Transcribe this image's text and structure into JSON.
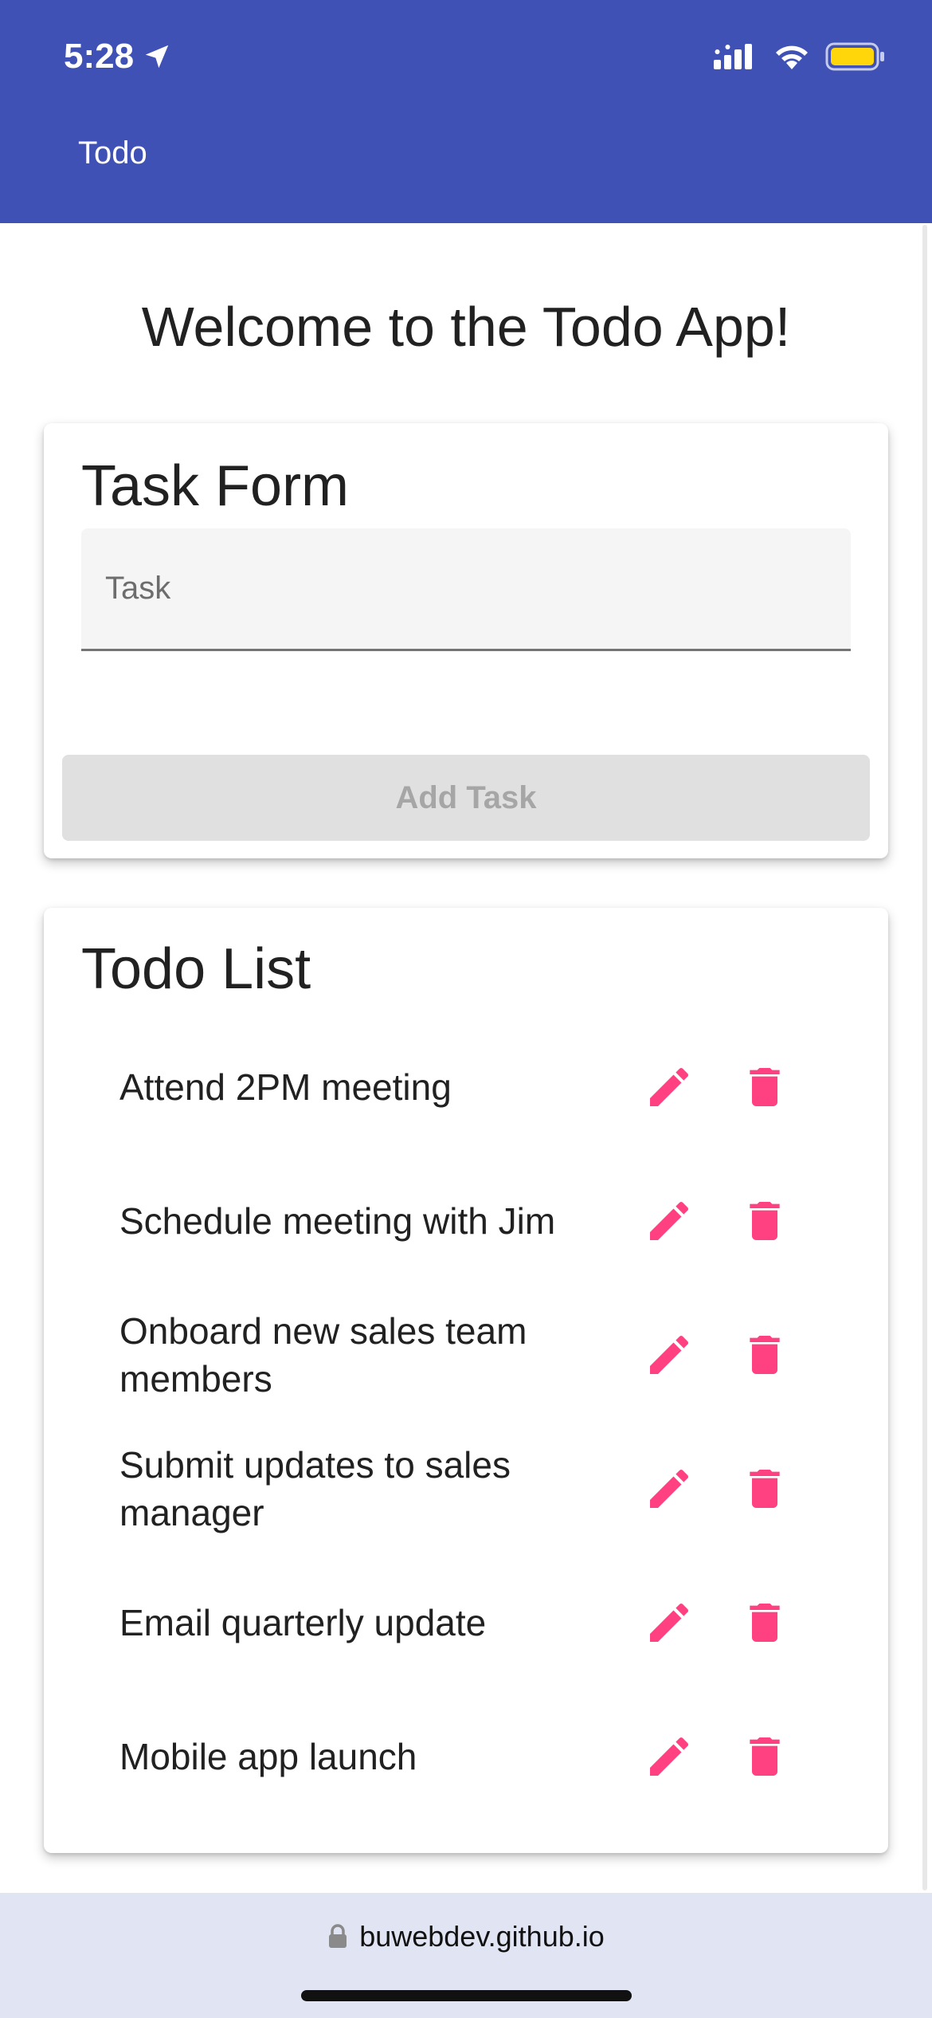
{
  "status_bar": {
    "time": "5:28"
  },
  "app_bar": {
    "title": "Todo"
  },
  "welcome": "Welcome to the Todo App!",
  "task_form": {
    "title": "Task Form",
    "input_placeholder": "Task",
    "input_value": "",
    "add_button_label": "Add Task"
  },
  "todo_list": {
    "title": "Todo List",
    "items": [
      {
        "text": "Attend 2PM meeting"
      },
      {
        "text": "Schedule meeting with Jim"
      },
      {
        "text": "Onboard new sales team members"
      },
      {
        "text": "Submit updates to sales manager"
      },
      {
        "text": "Email quarterly update"
      },
      {
        "text": "Mobile app launch"
      }
    ]
  },
  "browser": {
    "url": "buwebdev.github.io"
  },
  "colors": {
    "primary": "#3f51b5",
    "accent": "#ff4081",
    "bottom_bar": "#e1e5f3"
  },
  "icons": [
    "location-arrow-icon",
    "signal-icon",
    "wifi-icon",
    "battery-icon",
    "edit-icon",
    "delete-icon",
    "lock-icon"
  ]
}
